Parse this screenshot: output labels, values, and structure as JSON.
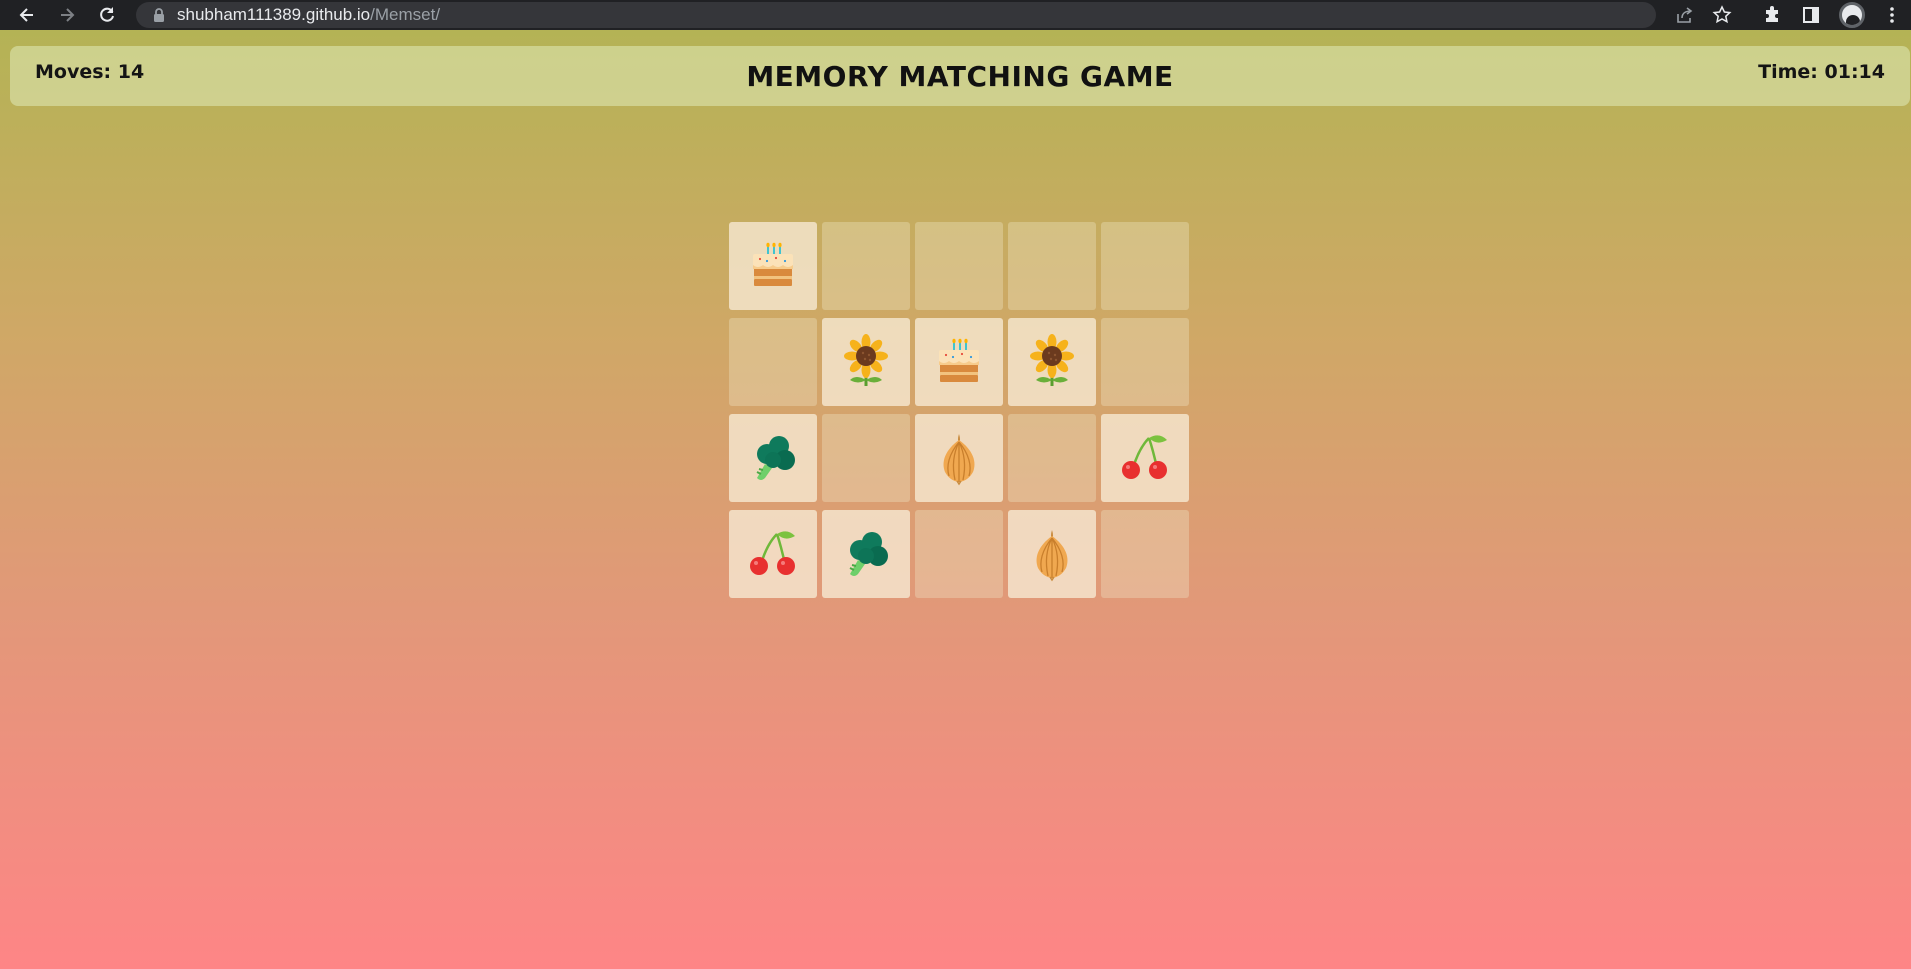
{
  "browser": {
    "url_host": "shubham111389.github.io",
    "url_path": "/Memset/"
  },
  "game": {
    "moves_label": "Moves: 14",
    "title": "MEMORY MATCHING GAME",
    "time_label": "Time: 01:14",
    "moves": 14,
    "time": "01:14",
    "rows": 4,
    "cols": 5,
    "cards": [
      {
        "row": 1,
        "col": 1,
        "face": "cake",
        "revealed": true
      },
      {
        "row": 1,
        "col": 2,
        "face": null,
        "revealed": false
      },
      {
        "row": 1,
        "col": 3,
        "face": null,
        "revealed": false
      },
      {
        "row": 1,
        "col": 4,
        "face": null,
        "revealed": false
      },
      {
        "row": 1,
        "col": 5,
        "face": null,
        "revealed": false
      },
      {
        "row": 2,
        "col": 1,
        "face": null,
        "revealed": false
      },
      {
        "row": 2,
        "col": 2,
        "face": "sunflower",
        "revealed": true
      },
      {
        "row": 2,
        "col": 3,
        "face": "cake",
        "revealed": true
      },
      {
        "row": 2,
        "col": 4,
        "face": "sunflower",
        "revealed": true
      },
      {
        "row": 2,
        "col": 5,
        "face": null,
        "revealed": false
      },
      {
        "row": 3,
        "col": 1,
        "face": "broccoli",
        "revealed": true
      },
      {
        "row": 3,
        "col": 2,
        "face": null,
        "revealed": false
      },
      {
        "row": 3,
        "col": 3,
        "face": "onion",
        "revealed": true
      },
      {
        "row": 3,
        "col": 4,
        "face": null,
        "revealed": false
      },
      {
        "row": 3,
        "col": 5,
        "face": "cherries",
        "revealed": true
      },
      {
        "row": 4,
        "col": 1,
        "face": "cherries",
        "revealed": true
      },
      {
        "row": 4,
        "col": 2,
        "face": "broccoli",
        "revealed": true
      },
      {
        "row": 4,
        "col": 3,
        "face": null,
        "revealed": false
      },
      {
        "row": 4,
        "col": 4,
        "face": "onion",
        "revealed": true
      },
      {
        "row": 4,
        "col": 5,
        "face": null,
        "revealed": false
      }
    ]
  }
}
